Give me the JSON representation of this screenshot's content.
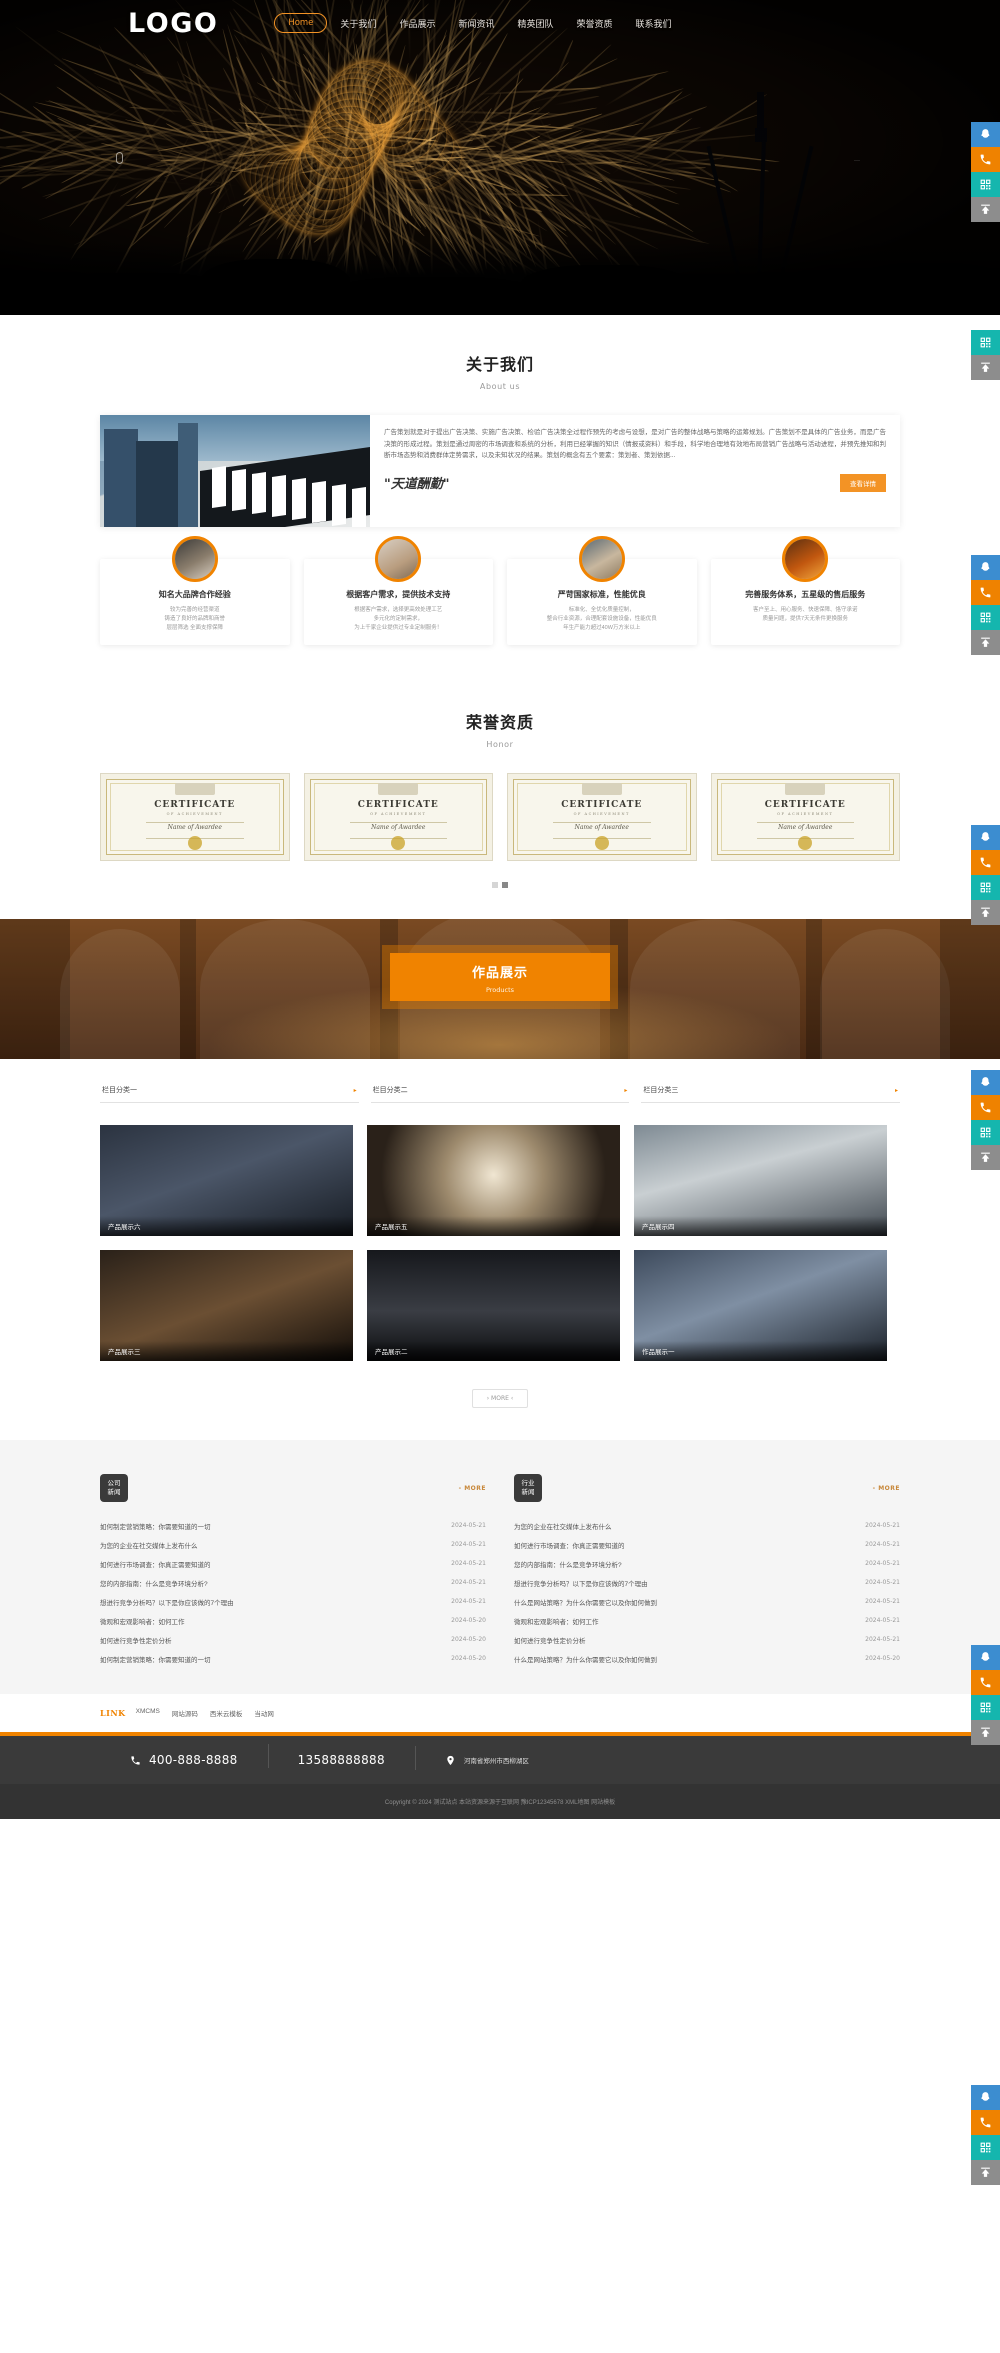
{
  "header": {
    "logo": "LOGO",
    "nav": [
      {
        "label": "Home",
        "active": true
      },
      {
        "label": "关于我们",
        "active": false
      },
      {
        "label": "作品展示",
        "active": false
      },
      {
        "label": "新闻资讯",
        "active": false
      },
      {
        "label": "精英团队",
        "active": false
      },
      {
        "label": "荣誉资质",
        "active": false
      },
      {
        "label": "联系我们",
        "active": false
      }
    ]
  },
  "side_toolbar": [
    {
      "name": "qq-icon",
      "label": "QQ"
    },
    {
      "name": "phone-icon",
      "label": "电话"
    },
    {
      "name": "qrcode-icon",
      "label": "二维码"
    },
    {
      "name": "back-to-top-icon",
      "label": "返回顶部"
    }
  ],
  "about": {
    "title": "关于我们",
    "subtitle": "About us",
    "body": "广告策划就是对于提出广告决策、实施广告决策、检验广告决策全过程作预先的考虑与设想，是对广告的整体战略与策略的运筹规划。广告策划不是具体的广告业务，而是广告决策的形成过程。策划是通过周密的市场调查和系统的分析，利用已经掌握的知识（情报或资料）和手段，科学地合理地有效地布局营销广告战略与活动进程，并预先推知和判断市场态势和消费群体定势需求，以及未知状况的结果。策划的概念有五个要素：策划者、策划依据...",
    "slogan": "\"天道酬勤\"",
    "button": "查看详情"
  },
  "features": [
    {
      "icon": "thumbs-up-photo",
      "title": "知名大品牌合作经验",
      "lines": [
        "较为完善的经营渠道",
        "铸造了良好的品牌和商誉",
        "层层筛选 全面支撑保障"
      ]
    },
    {
      "icon": "handshake-photo",
      "title": "根据客户需求，提供技术支持",
      "lines": [
        "根据客户需求，选择更高效处理工艺",
        "多元化的定制需求，",
        "为上千家企业提供过专业定制服务！"
      ]
    },
    {
      "icon": "factory-photo",
      "title": "严苛国家标准，性能优良",
      "lines": [
        "标准化、全优化质量控制，",
        "整合行业资源，合理配套设施设备，性能优良",
        "年生产能力超过40W万方米以上"
      ]
    },
    {
      "icon": "team-photo",
      "title": "完善服务体系，五星级的售后服务",
      "lines": [
        "客户至上、用心服务、快速保障、恪守承诺",
        "质量问题，提供7天无条件更换服务"
      ]
    }
  ],
  "honor": {
    "title": "荣誉资质",
    "subtitle": "Honor",
    "certificates": [
      {
        "title": "CERTIFICATE",
        "sub": "OF ACHIEVEMENT",
        "name": "Name of Awardee"
      },
      {
        "title": "CERTIFICATE",
        "sub": "OF ACHIEVEMENT",
        "name": "Name of Awardee"
      },
      {
        "title": "CERTIFICATE",
        "sub": "OF ACHIEVEMENT",
        "name": "Name of Awardee"
      },
      {
        "title": "CERTIFICATE",
        "sub": "OF ACHIEVEMENT",
        "name": "Name of Awardee"
      }
    ],
    "dots": 2,
    "active_dot": 1
  },
  "products": {
    "banner_title": "作品展示",
    "banner_subtitle": "Products",
    "tabs": [
      {
        "label": "栏目分类一",
        "arrow": "▸"
      },
      {
        "label": "栏目分类二",
        "arrow": "▸"
      },
      {
        "label": "栏目分类三",
        "arrow": "▸"
      }
    ],
    "items": [
      {
        "caption": "产品展示六",
        "theme": "gothic-hall"
      },
      {
        "caption": "产品展示五",
        "theme": "spiral-stair"
      },
      {
        "caption": "产品展示四",
        "theme": "station-clock"
      },
      {
        "caption": "产品展示三",
        "theme": "museum-gallery"
      },
      {
        "caption": "产品展示二",
        "theme": "statue-hall"
      },
      {
        "caption": "作品展示一",
        "theme": "grand-hall"
      }
    ],
    "more": "› MORE ‹"
  },
  "news": {
    "columns": [
      {
        "tag_line1": "公司",
        "tag_line2": "新闻",
        "more": "- MORE",
        "items": [
          {
            "title": "如何制定营销策略：你需要知道的一切",
            "date": "2024-05-21"
          },
          {
            "title": "为您的企业在社交媒体上发布什么",
            "date": "2024-05-21"
          },
          {
            "title": "如何进行市场调查：你真正需要知道的",
            "date": "2024-05-21"
          },
          {
            "title": "您的内部指南：什么是竞争环境分析?",
            "date": "2024-05-21"
          },
          {
            "title": "想进行竞争分析吗？以下是你应该做的7个理由",
            "date": "2024-05-21"
          },
          {
            "title": "微观和宏观影响者：如何工作",
            "date": "2024-05-20"
          },
          {
            "title": "如何进行竞争性定价分析",
            "date": "2024-05-20"
          },
          {
            "title": "如何制定营销策略：你需要知道的一切",
            "date": "2024-05-20"
          }
        ]
      },
      {
        "tag_line1": "行业",
        "tag_line2": "新闻",
        "more": "- MORE",
        "items": [
          {
            "title": "为您的企业在社交媒体上发布什么",
            "date": "2024-05-21"
          },
          {
            "title": "如何进行市场调查：你真正需要知道的",
            "date": "2024-05-21"
          },
          {
            "title": "您的内部指南：什么是竞争环境分析?",
            "date": "2024-05-21"
          },
          {
            "title": "想进行竞争分析吗？以下是你应该做的7个理由",
            "date": "2024-05-21"
          },
          {
            "title": "什么是网站策略？为什么你需要它以及你如何做到",
            "date": "2024-05-21"
          },
          {
            "title": "微观和宏观影响者：如何工作",
            "date": "2024-05-21"
          },
          {
            "title": "如何进行竞争性定价分析",
            "date": "2024-05-21"
          },
          {
            "title": "什么是网站策略？为什么你需要它以及你如何做到",
            "date": "2024-05-20"
          }
        ]
      }
    ]
  },
  "links": {
    "title": "LINK",
    "items": [
      "XMCMS",
      "网站源码",
      "西米云模板",
      "当动网"
    ]
  },
  "footer": {
    "phone_primary": "400-888-8888",
    "phone_secondary": "13588888888",
    "address": "河南省郑州市西柳湖区",
    "copyright": "Copyright © 2024 测试站点 本站资源来源于互联网 豫ICP12345678 XML地图 网站模板"
  },
  "colors": {
    "accent": "#f08300",
    "qq_blue": "#3c8dd0",
    "qr_teal": "#15b6ae",
    "gray": "#8d8d8d",
    "dark": "#3a3a3a"
  }
}
